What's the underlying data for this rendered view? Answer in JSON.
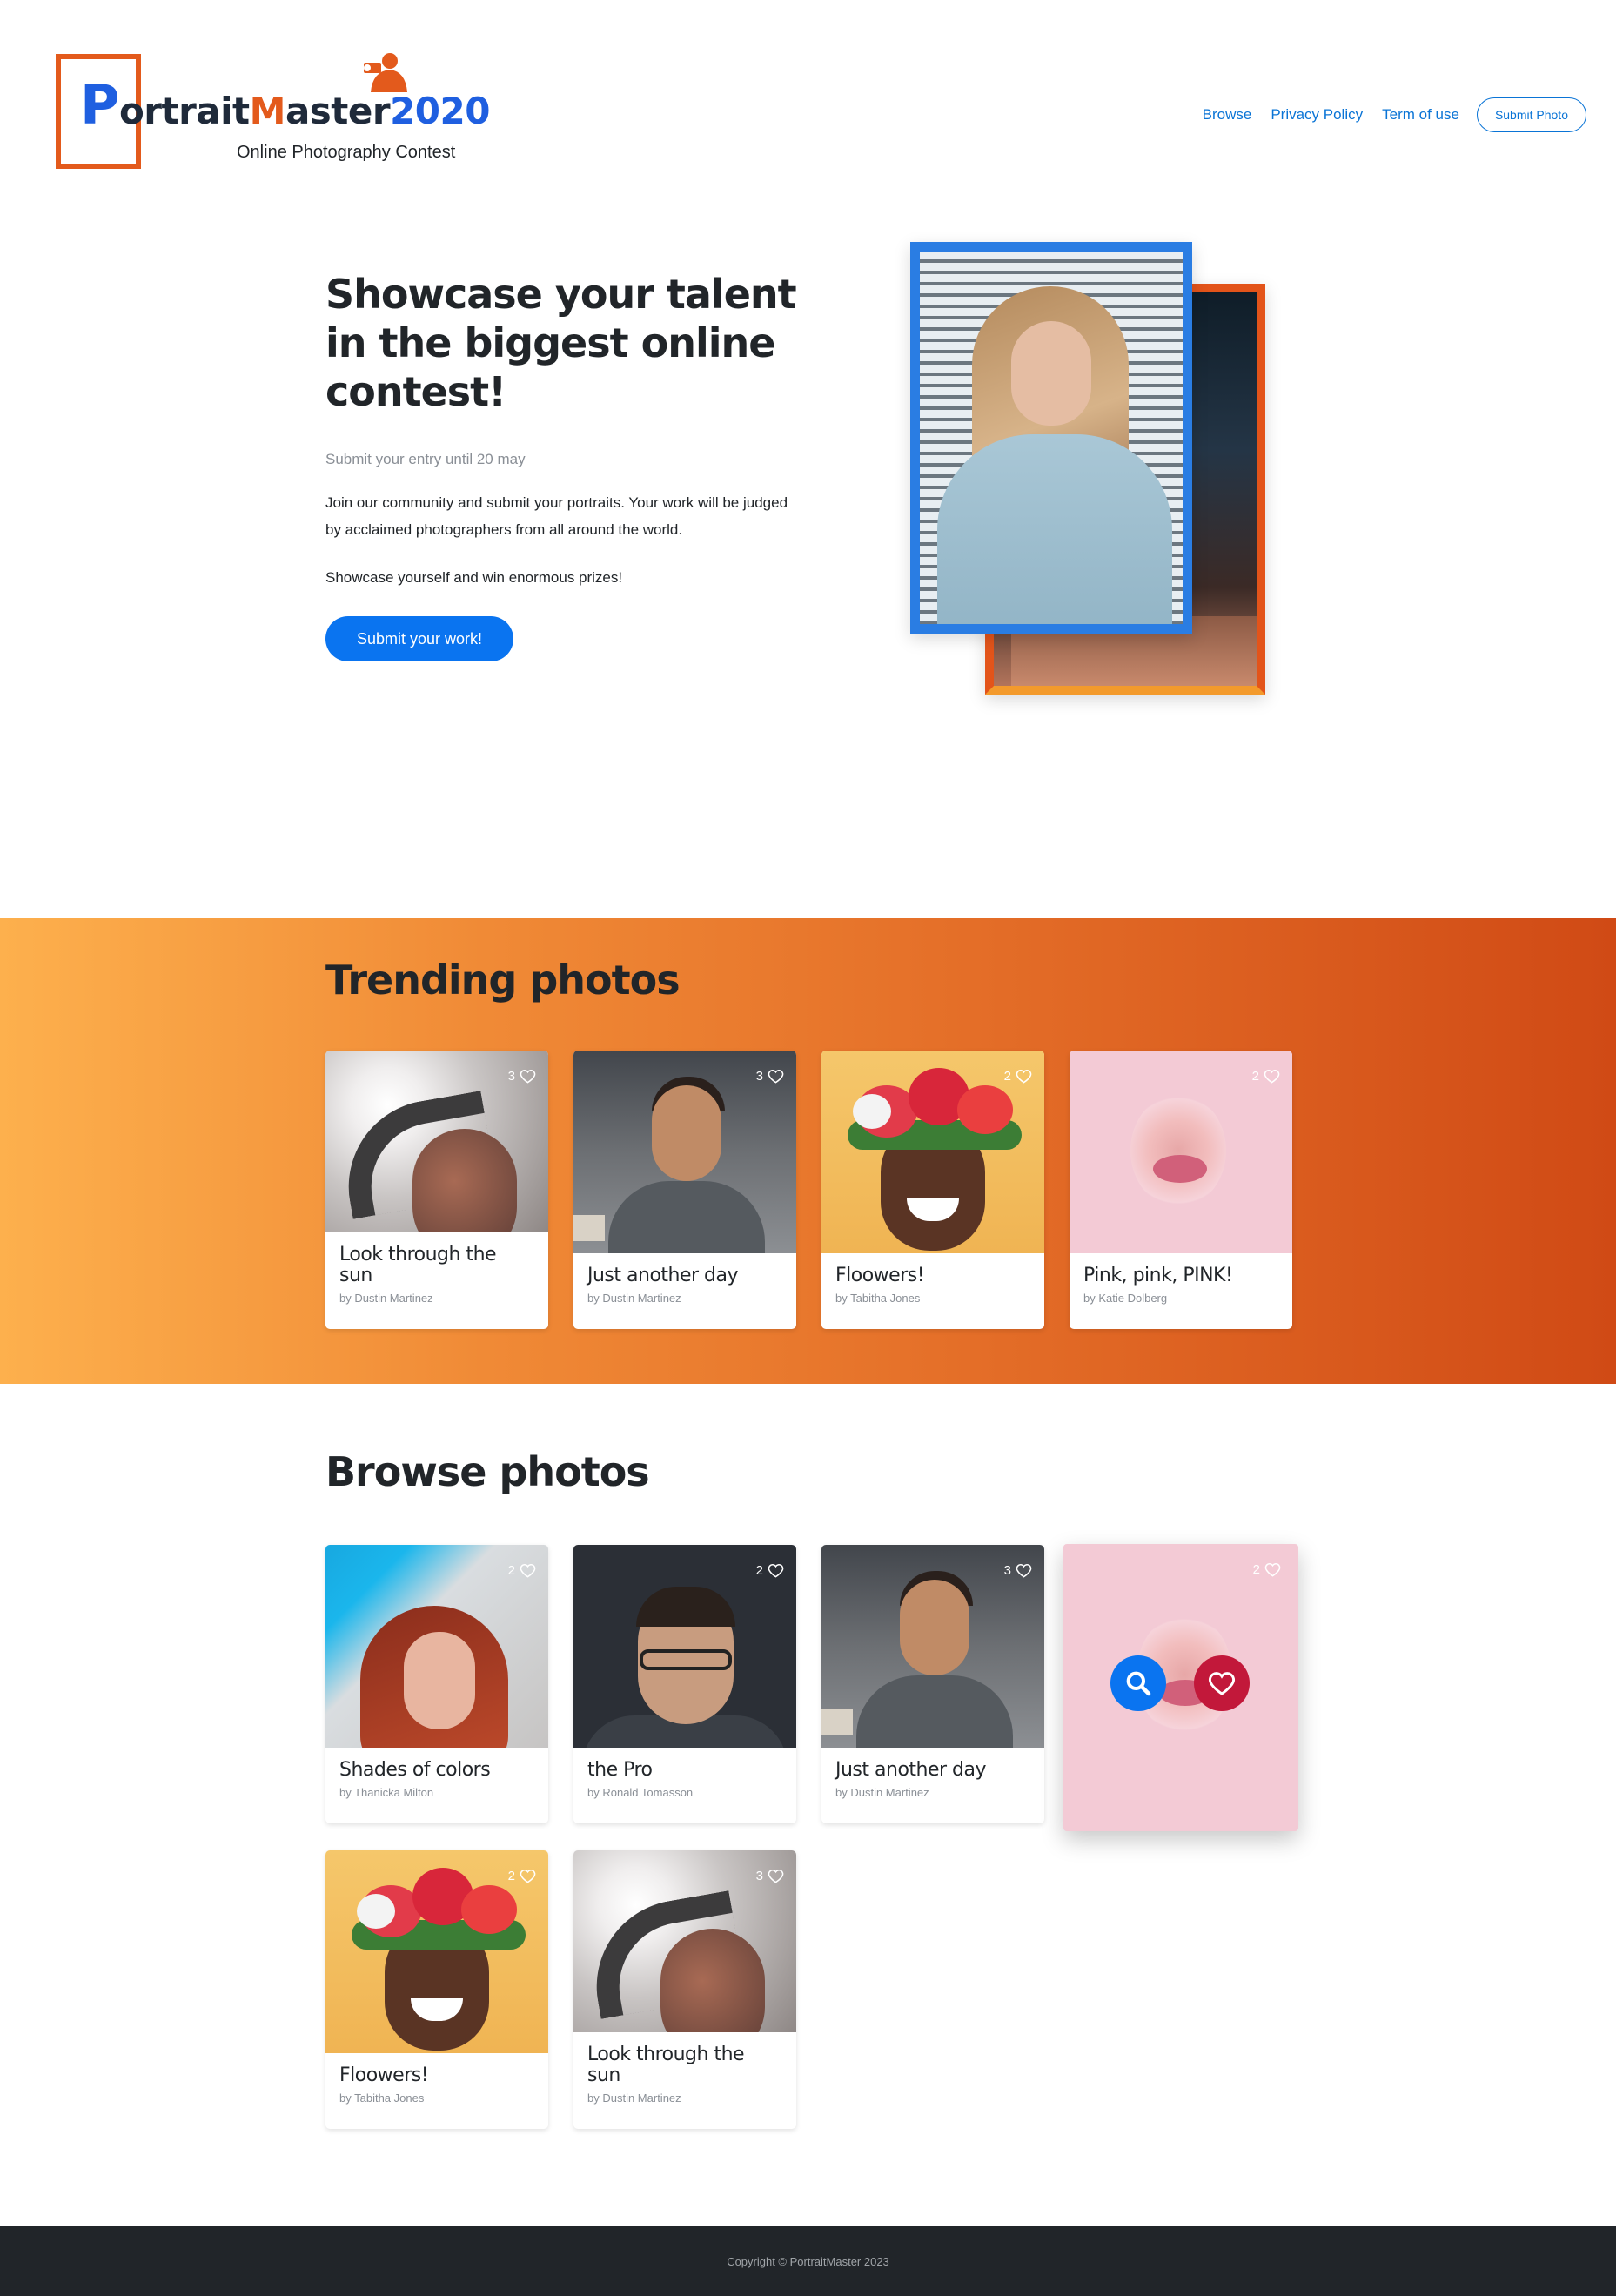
{
  "header": {
    "logo": {
      "p": "P",
      "ortrait": "ortrait",
      "m": "M",
      "aster": "aster",
      "year": "2020",
      "subtitle": "Online Photography Contest"
    },
    "nav": [
      {
        "label": "Browse"
      },
      {
        "label": "Privacy Policy"
      },
      {
        "label": "Term of use"
      }
    ],
    "submit_label": "Submit Photo"
  },
  "hero": {
    "title": "Showcase your talent in the biggest online contest!",
    "deadline": "Submit your entry until 20 may",
    "paragraph": "Join our community and submit your portraits. Your work will be judged by acclaimed photographers from all around the world.",
    "cta_text": "Showcase yourself and win enormous prizes!",
    "button_label": "Submit your work!"
  },
  "trending": {
    "title": "Trending photos",
    "cards": [
      {
        "title": "Look through the sun",
        "author": "by Dustin Martinez",
        "likes": "3"
      },
      {
        "title": "Just another day",
        "author": "by Dustin Martinez",
        "likes": "3"
      },
      {
        "title": "Floowers!",
        "author": "by Tabitha Jones",
        "likes": "2"
      },
      {
        "title": "Pink, pink, PINK!",
        "author": "by Katie Dolberg",
        "likes": "2"
      }
    ]
  },
  "browse": {
    "title": "Browse photos",
    "cards": [
      {
        "title": "Shades of colors",
        "author": "by Thanicka Milton",
        "likes": "2"
      },
      {
        "title": "the Pro",
        "author": "by Ronald Tomasson",
        "likes": "2"
      },
      {
        "title": "Just another day",
        "author": "by Dustin Martinez",
        "likes": "3"
      },
      {
        "title": "",
        "author": "",
        "likes": "2"
      },
      {
        "title": "Floowers!",
        "author": "by Tabitha Jones",
        "likes": "2"
      },
      {
        "title": "Look through the sun",
        "author": "by Dustin Martinez",
        "likes": "3"
      }
    ]
  },
  "footer": {
    "copyright": "Copyright © PortraitMaster 2023"
  },
  "colors": {
    "accent": "#0a74f0",
    "orange": "#e35a1c",
    "heart": "#c2183a",
    "footer": "#212529"
  }
}
